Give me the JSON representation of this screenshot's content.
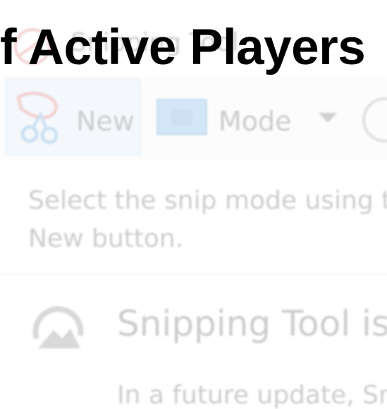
{
  "overlay": {
    "heading": "f Active Players"
  },
  "window": {
    "title": "Snipping Tool",
    "toolbar": {
      "new_label": "New",
      "mode_label": "Mode",
      "new_icon": "scissors-icon",
      "mode_icon": "snip-mode-icon",
      "delay_icon": "clock-icon"
    },
    "hint_line1": "Select the snip mode using t",
    "hint_line2": "New button.",
    "notice": {
      "icon": "snip-sketch-icon",
      "title": "Snipping Tool is",
      "body": "In a future update, Sn"
    },
    "colors": {
      "accent": "#3d97e0",
      "selected_bg": "#cfe4f7"
    }
  }
}
